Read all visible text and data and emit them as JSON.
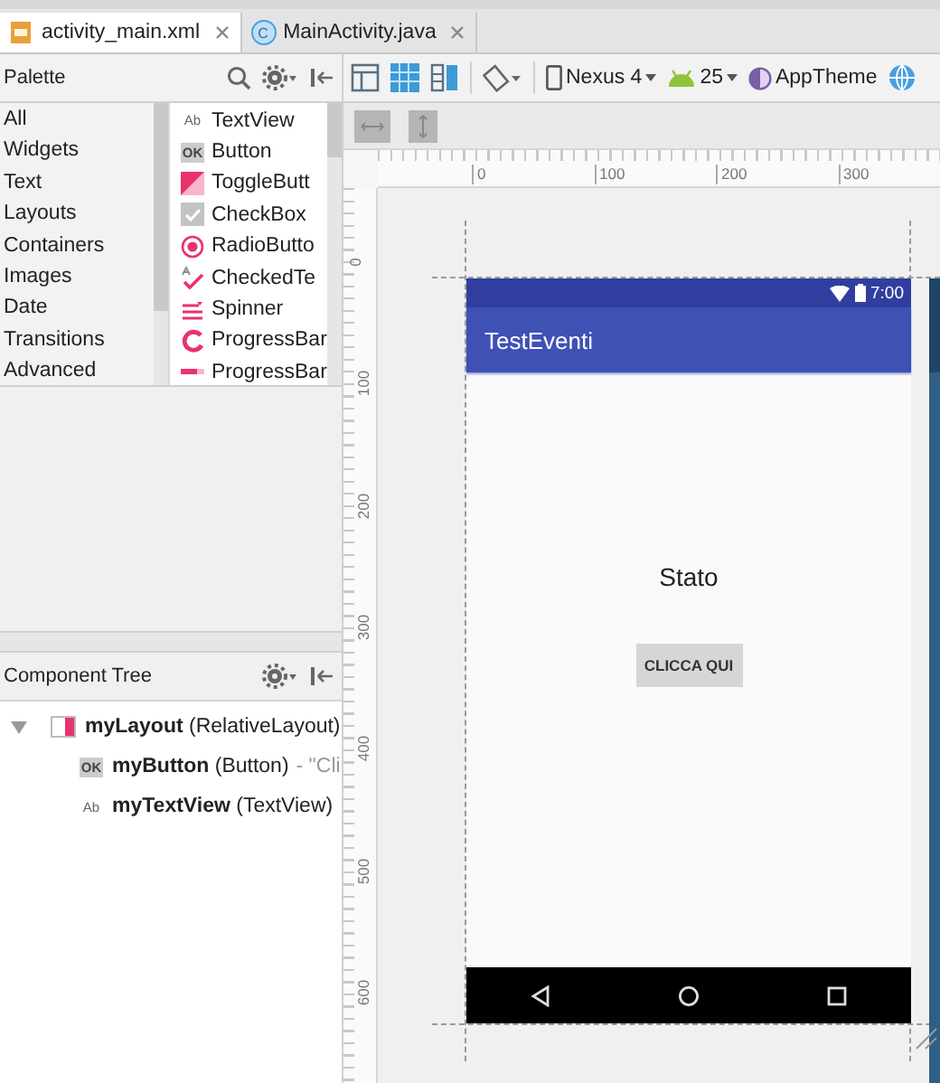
{
  "editor_tabs": [
    {
      "label": "activity_main.xml",
      "selected": true,
      "kind": "xml"
    },
    {
      "label": "MainActivity.java",
      "selected": false,
      "kind": "java",
      "badge": "C"
    }
  ],
  "palette": {
    "title": "Palette",
    "categories": [
      "All",
      "Widgets",
      "Text",
      "Layouts",
      "Containers",
      "Images",
      "Date",
      "Transitions",
      "Advanced"
    ],
    "items": [
      {
        "label": "TextView",
        "kind": "text",
        "badge": "Ab"
      },
      {
        "label": "Button",
        "kind": "button",
        "badge": "OK"
      },
      {
        "label": "ToggleButt",
        "kind": "toggle"
      },
      {
        "label": "CheckBox",
        "kind": "checkbox"
      },
      {
        "label": "RadioButto",
        "kind": "radio"
      },
      {
        "label": "CheckedTe",
        "kind": "checkedtext"
      },
      {
        "label": "Spinner",
        "kind": "spinner"
      },
      {
        "label": "ProgressBar",
        "kind": "progress-circle"
      },
      {
        "label": "ProgressBar",
        "kind": "progress-bar"
      }
    ]
  },
  "toolbar": {
    "device": "Nexus 4",
    "api": "25",
    "theme": "AppTheme"
  },
  "rulers": {
    "horizontal": [
      "0",
      "100",
      "200",
      "300"
    ],
    "vertical": [
      "0",
      "100",
      "200",
      "300",
      "400",
      "500",
      "600"
    ]
  },
  "component_tree": {
    "title": "Component Tree",
    "nodes": [
      {
        "name": "myLayout",
        "type": "(RelativeLayout)",
        "kind": "layout",
        "expanded": true,
        "children": [
          {
            "name": "myButton",
            "type": "(Button)",
            "detail": "- \"Cli",
            "kind": "button",
            "badge": "OK"
          },
          {
            "name": "myTextView",
            "type": "(TextView)",
            "kind": "text",
            "badge": "Ab"
          }
        ]
      }
    ]
  },
  "device_preview": {
    "time": "7:00",
    "app_title": "TestEventi",
    "text": "Stato",
    "button": "CLICCA QUI"
  }
}
